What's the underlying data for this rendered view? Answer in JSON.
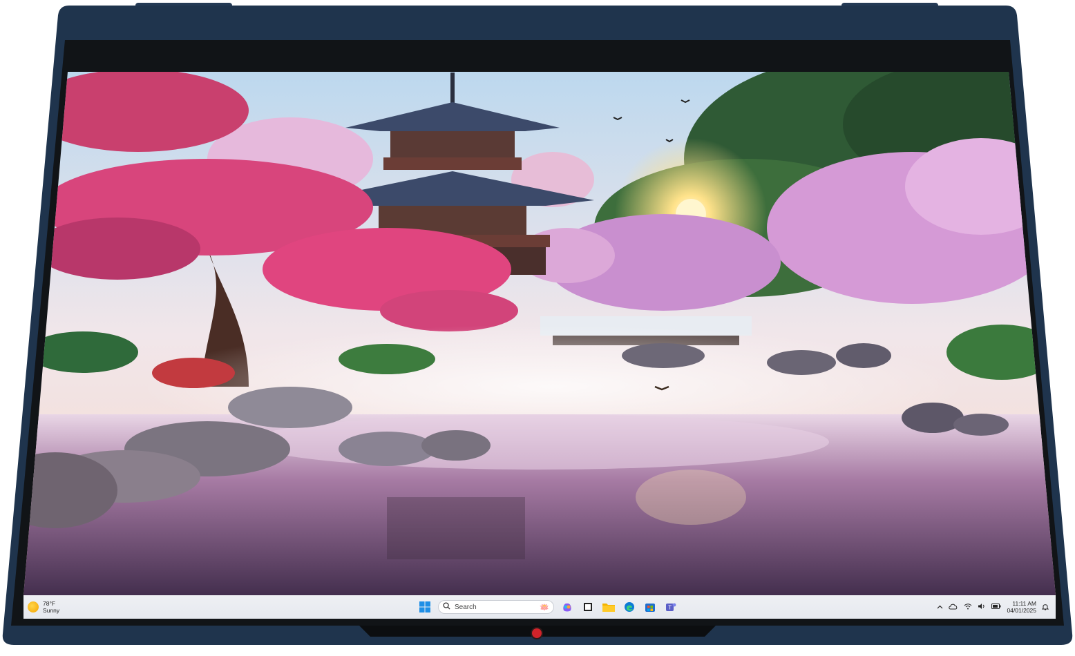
{
  "device": {
    "frame_color": "#1f344d",
    "bezel_color": "#111417",
    "camera_color": "#d1232a"
  },
  "wallpaper": {
    "palette": {
      "sky": "#cfe4f2",
      "blossom_pink": "#e0457f",
      "blossom_lilac": "#d59ad6",
      "pagoda": "#2a2f3e",
      "water": "#7b5a86",
      "foliage": "#2f6a3a",
      "sun": "#ffe28a"
    }
  },
  "taskbar": {
    "weather": {
      "temp": "78°F",
      "condition": "Sunny",
      "icon": "sun-icon"
    },
    "search": {
      "placeholder": "Search"
    },
    "pinned_apps": [
      {
        "name": "start",
        "icon": "windows-start-icon"
      },
      {
        "name": "copilot",
        "icon": "copilot-icon"
      },
      {
        "name": "task-view",
        "icon": "task-view-icon"
      },
      {
        "name": "file-explorer",
        "icon": "folder-icon"
      },
      {
        "name": "edge",
        "icon": "edge-icon"
      },
      {
        "name": "store",
        "icon": "store-icon"
      },
      {
        "name": "teams",
        "icon": "teams-icon"
      }
    ],
    "tray": {
      "time": "11:11 AM",
      "date": "04/01/2025",
      "icons": [
        "chevron-up-icon",
        "cloud-icon",
        "wifi-icon",
        "volume-icon",
        "battery-icon",
        "bell-icon"
      ]
    }
  }
}
